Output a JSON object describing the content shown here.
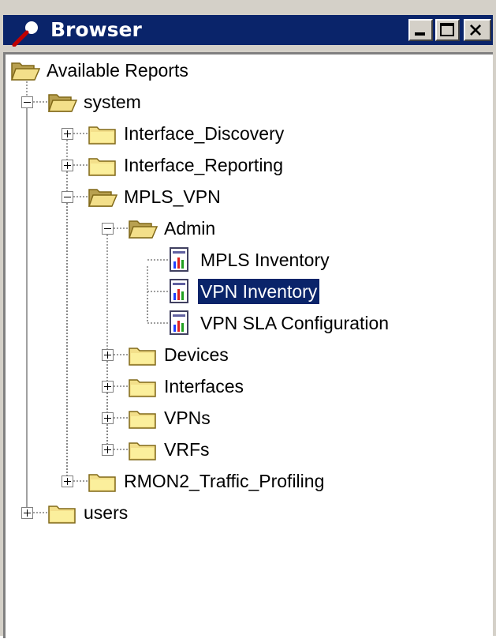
{
  "window": {
    "title": "Browser",
    "buttons": [
      "minimize",
      "maximize",
      "close"
    ]
  },
  "tree": {
    "root": {
      "label": "Available Reports",
      "icon": "open-folder-icon"
    },
    "nodes": [
      {
        "label": "system",
        "level": 1,
        "icon": "open-folder-icon",
        "expanded": true
      },
      {
        "label": "Interface_Discovery",
        "level": 2,
        "icon": "closed-folder-icon",
        "expanded": false
      },
      {
        "label": "Interface_Reporting",
        "level": 2,
        "icon": "closed-folder-icon",
        "expanded": false
      },
      {
        "label": "MPLS_VPN",
        "level": 2,
        "icon": "open-folder-icon",
        "expanded": true
      },
      {
        "label": "Admin",
        "level": 3,
        "icon": "open-folder-icon",
        "expanded": true
      },
      {
        "label": "MPLS Inventory",
        "level": 4,
        "icon": "report-icon"
      },
      {
        "label": "VPN Inventory",
        "level": 4,
        "icon": "report-icon",
        "selected": true
      },
      {
        "label": "VPN SLA Configuration",
        "level": 4,
        "icon": "report-icon"
      },
      {
        "label": "Devices",
        "level": 3,
        "icon": "closed-folder-icon",
        "expanded": false
      },
      {
        "label": "Interfaces",
        "level": 3,
        "icon": "closed-folder-icon",
        "expanded": false
      },
      {
        "label": "VPNs",
        "level": 3,
        "icon": "closed-folder-icon",
        "expanded": false
      },
      {
        "label": "VRFs",
        "level": 3,
        "icon": "closed-folder-icon",
        "expanded": false
      },
      {
        "label": "RMON2_Traffic_Profiling",
        "level": 2,
        "icon": "closed-folder-icon",
        "expanded": false
      },
      {
        "label": "users",
        "level": 1,
        "icon": "closed-folder-icon",
        "expanded": false
      }
    ]
  },
  "colors": {
    "titlebar": "#0a246a",
    "selection": "#0a246a",
    "folder": "#f3df8a"
  }
}
